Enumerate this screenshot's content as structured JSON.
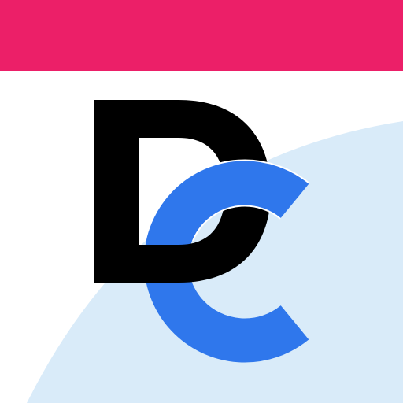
{
  "icon": {
    "name": "dc-app-icon",
    "monogram": "DC",
    "monogram_letters": [
      "D",
      "C"
    ]
  },
  "colors": {
    "top_bar": "#ec1f68",
    "background": "#ffffff",
    "wave": "#d9ebf9",
    "letter_d": "#000000",
    "letter_c": "#2f77ec",
    "letter_c_outline": "#ffffff"
  }
}
